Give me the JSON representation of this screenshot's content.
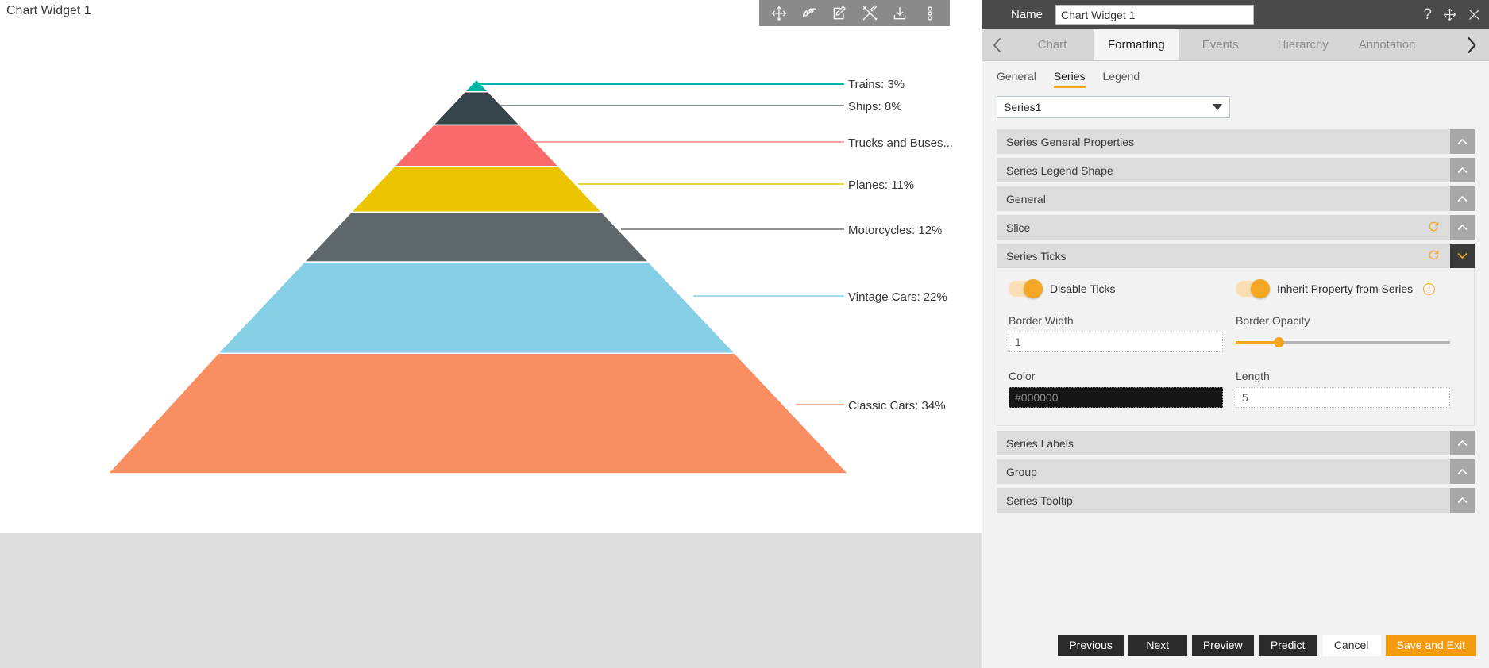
{
  "chart_pane": {
    "title": "Chart Widget 1",
    "toolbar": [
      {
        "name": "move-icon",
        "label": "Move"
      },
      {
        "name": "scribble-icon",
        "label": "Scribble"
      },
      {
        "name": "edit-icon",
        "label": "Edit"
      },
      {
        "name": "tools-icon",
        "label": "Tools"
      },
      {
        "name": "download-icon",
        "label": "Download"
      },
      {
        "name": "more-options-icon",
        "label": "More options"
      }
    ]
  },
  "chart_data": {
    "type": "pie",
    "subtype": "pyramid",
    "title": "Chart Widget 1",
    "categories": [
      "Trains",
      "Ships",
      "Trucks and Buses",
      "Planes",
      "Motorcycles",
      "Vintage Cars",
      "Classic Cars"
    ],
    "values": [
      3,
      8,
      10,
      11,
      12,
      22,
      34
    ],
    "unit": "%",
    "labels": [
      {
        "text": "Trains: 3%",
        "color": "#00b3a4"
      },
      {
        "text": "Ships: 8%",
        "color": "#36454c"
      },
      {
        "text": "Trucks and Buses...",
        "color": "#fb6a6a"
      },
      {
        "text": "Planes: 11%",
        "color": "#ecc400"
      },
      {
        "text": "Motorcycles: 12%",
        "color": "#5e686c"
      },
      {
        "text": "Vintage Cars: 22%",
        "color": "#85d0e7"
      },
      {
        "text": "Classic Cars: 34%",
        "color": "#f98e63"
      }
    ],
    "colors": [
      "#00b3a4",
      "#36454c",
      "#fb6a6a",
      "#ecc400",
      "#5e686c",
      "#85d0e7",
      "#f98e63"
    ],
    "legend": "leader-lines-right",
    "grid": false
  },
  "panel": {
    "header": {
      "name_label": "Name",
      "name_value": "Chart Widget 1",
      "help_icon": "?",
      "move_icon": "move",
      "close_icon": "close"
    },
    "tabs": {
      "prev_arrow": "‹",
      "next_arrow": "›",
      "items": [
        {
          "label": "Chart",
          "active": false
        },
        {
          "label": "Formatting",
          "active": true
        },
        {
          "label": "Events",
          "active": false
        },
        {
          "label": "Hierarchy",
          "active": false
        },
        {
          "label": "Annotation",
          "active": false
        }
      ]
    },
    "subtabs": [
      {
        "label": "General",
        "active": false
      },
      {
        "label": "Series",
        "active": true
      },
      {
        "label": "Legend",
        "active": false
      }
    ],
    "series_select": {
      "value": "Series1",
      "options": [
        "Series1"
      ]
    },
    "accordions": [
      {
        "label": "Series General Properties",
        "open": false,
        "refresh": false
      },
      {
        "label": "Series Legend Shape",
        "open": false,
        "refresh": false
      },
      {
        "label": "General",
        "open": false,
        "refresh": false
      },
      {
        "label": "Slice",
        "open": false,
        "refresh": true
      },
      {
        "label": "Series Ticks",
        "open": true,
        "refresh": true
      }
    ],
    "accordions_after": [
      {
        "label": "Series Labels",
        "open": false,
        "refresh": false
      },
      {
        "label": "Group",
        "open": false,
        "refresh": false
      },
      {
        "label": "Series Tooltip",
        "open": false,
        "refresh": false
      }
    ],
    "series_ticks": {
      "disable_ticks_label": "Disable Ticks",
      "disable_ticks_on": true,
      "inherit_label": "Inherit Property from Series",
      "inherit_on": true,
      "border_width_label": "Border Width",
      "border_width_value": "1",
      "border_opacity_label": "Border Opacity",
      "border_opacity_percent": 20,
      "color_label": "Color",
      "color_value": "#000000",
      "length_label": "Length",
      "length_value": "5"
    },
    "footer": [
      {
        "label": "Previous",
        "style": "dark"
      },
      {
        "label": "Next",
        "style": "dark"
      },
      {
        "label": "Preview",
        "style": "dark"
      },
      {
        "label": "Predict",
        "style": "dark"
      },
      {
        "label": "Cancel",
        "style": "light"
      },
      {
        "label": "Save and Exit",
        "style": "accent"
      }
    ]
  },
  "theme": {
    "accent": "#f5a623",
    "panel_bg": "#f2f2f2",
    "header_bg": "#4a4a4a",
    "accordion_bg": "#dcdcdc"
  }
}
